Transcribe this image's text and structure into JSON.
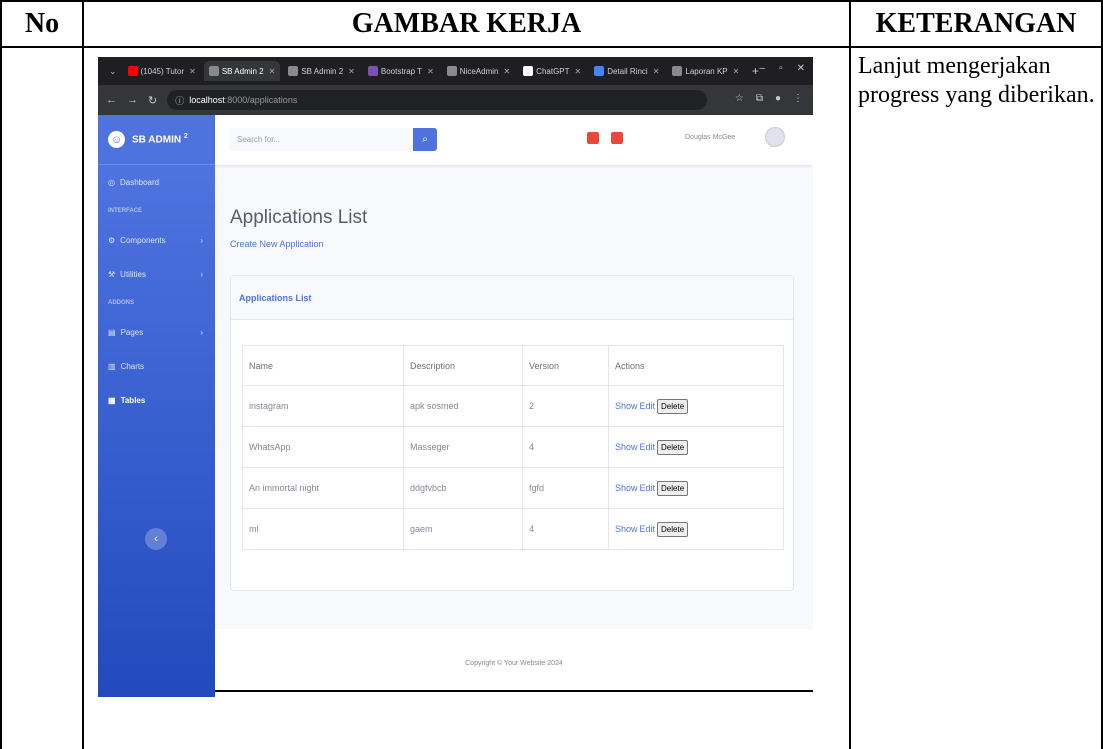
{
  "document": {
    "col_no": "No",
    "col_gambar": "GAMBAR KERJA",
    "col_keterangan": "KETERANGAN",
    "keterangan_text": "Lanjut mengerjakan progress yang diberikan."
  },
  "browser": {
    "tabs": [
      {
        "label": "(1045) Tutor",
        "fav_color": "#ff0000"
      },
      {
        "label": "SB Admin 2",
        "fav_color": "#8a8a8a",
        "active": true
      },
      {
        "label": "SB Admin 2",
        "fav_color": "#8a8a8a"
      },
      {
        "label": "Bootstrap T",
        "fav_color": "#7952b3"
      },
      {
        "label": "NiceAdmin",
        "fav_color": "#8a8a8a"
      },
      {
        "label": "ChatGPT",
        "fav_color": "#ffffff"
      },
      {
        "label": "Detail Rinci",
        "fav_color": "#4285f4"
      },
      {
        "label": "Laporan KP",
        "fav_color": "#8a8a8a"
      }
    ],
    "url_host": "localhost",
    "url_path": ":8000/applications"
  },
  "sidebar": {
    "brand": "SB ADMIN",
    "brand_sup": "2",
    "dashboard": "Dashboard",
    "heading_interface": "INTERFACE",
    "components": "Components",
    "utilities": "Utilities",
    "heading_addons": "ADDONS",
    "pages": "Pages",
    "charts": "Charts",
    "tables": "Tables"
  },
  "topbar": {
    "search_placeholder": "Search for...",
    "user_name": "Douglas McGee"
  },
  "main": {
    "page_title": "Applications List",
    "create_link": "Create New Application",
    "card_title": "Applications List",
    "columns": [
      "Name",
      "Description",
      "Version",
      "Actions"
    ],
    "rows": [
      {
        "name": "instagram",
        "description": "apk sosmed",
        "version": "2"
      },
      {
        "name": "WhatsApp",
        "description": "Masseger",
        "version": "4"
      },
      {
        "name": "An immortal night",
        "description": "ddgfvbcb",
        "version": "fgfd"
      },
      {
        "name": "ml",
        "description": "gaem",
        "version": "4"
      }
    ],
    "action_show": "Show",
    "action_edit": "Edit",
    "action_delete": "Delete"
  },
  "footer": {
    "copyright": "Copyright © Your Website 2024"
  },
  "colors": {
    "primary": "#4e73df",
    "sidebar_dark": "#224abe"
  }
}
